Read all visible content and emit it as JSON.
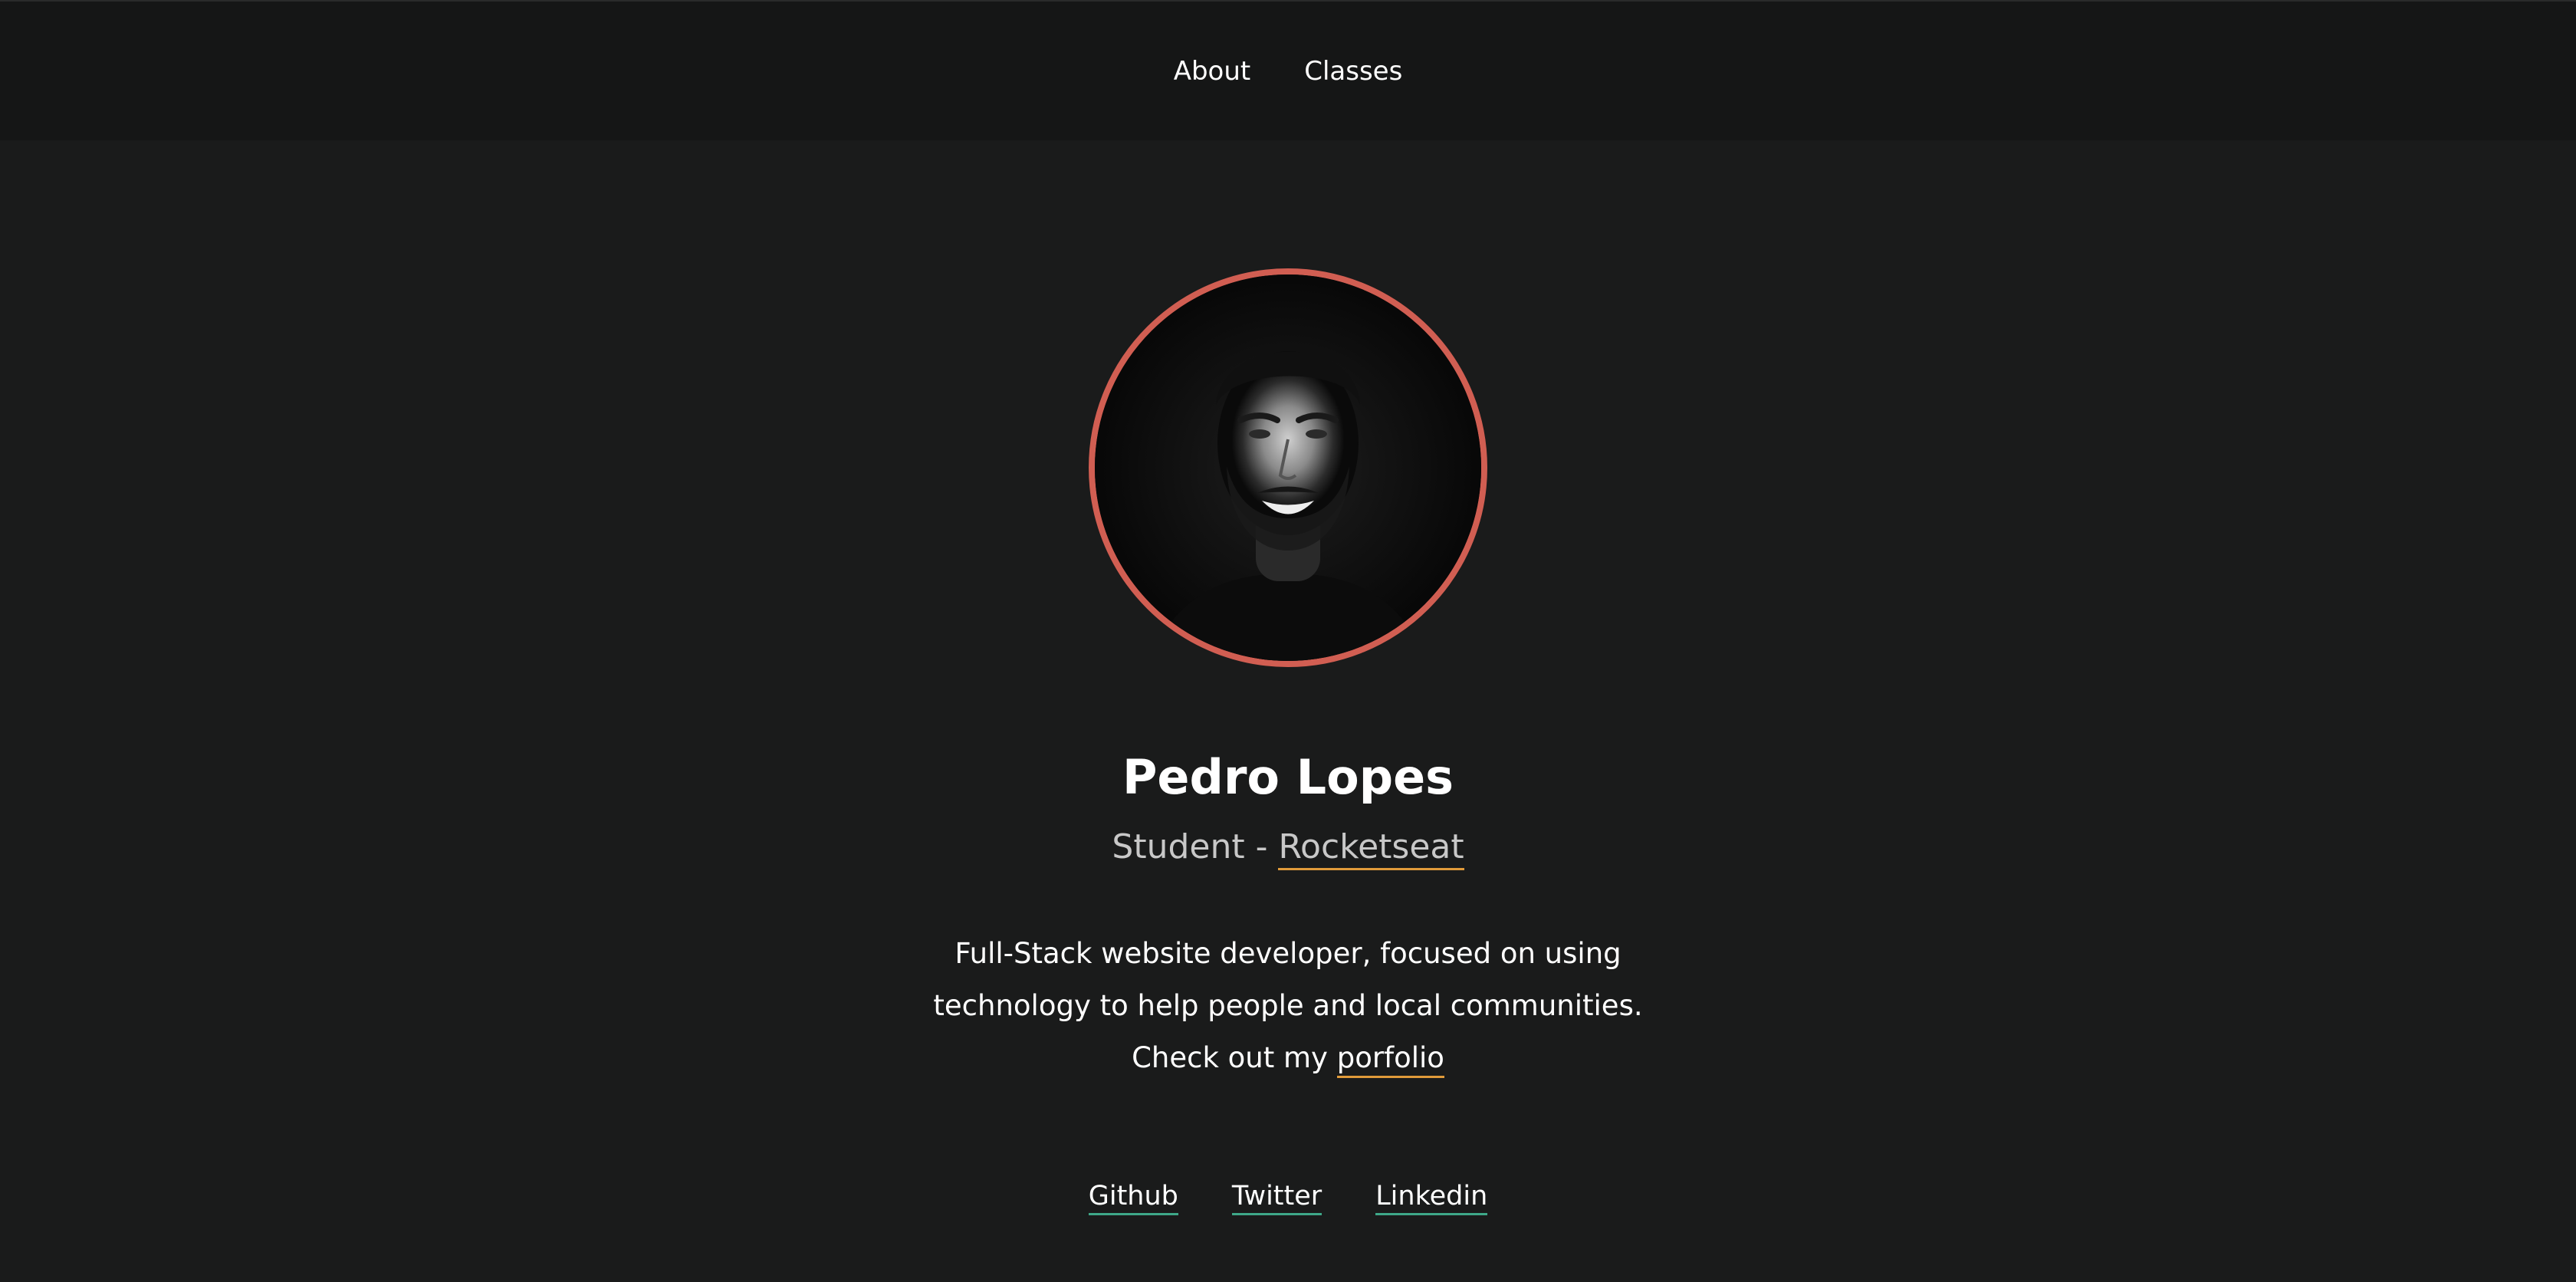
{
  "nav": {
    "items": [
      {
        "label": "About"
      },
      {
        "label": "Classes"
      }
    ]
  },
  "profile": {
    "name": "Pedro Lopes",
    "role_prefix": "Student - ",
    "role_link": "Rocketseat",
    "bio_line1": "Full-Stack website developer, focused on using",
    "bio_line2": "technology to help people and local communities.",
    "bio_cta_prefix": "Check out my ",
    "bio_cta_link": "porfolio"
  },
  "social": {
    "links": [
      {
        "label": "Github"
      },
      {
        "label": "Twitter"
      },
      {
        "label": "Linkedin"
      }
    ]
  },
  "colors": {
    "background": "#1a1b1b",
    "topbar": "#151616",
    "avatar_ring": "#d15e52",
    "accent_orange": "#e09a3a",
    "accent_green": "#3ea888"
  }
}
